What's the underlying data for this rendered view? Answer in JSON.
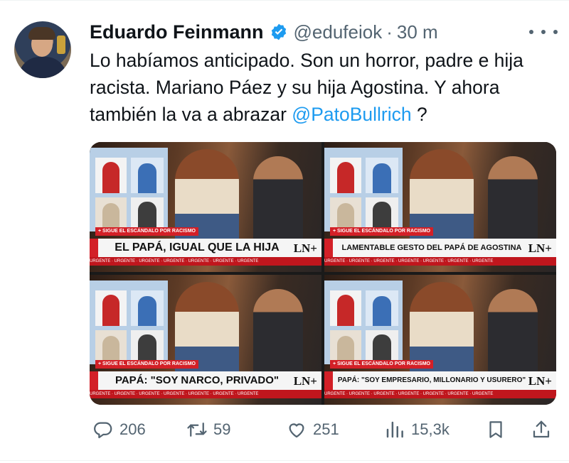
{
  "tweet": {
    "author_name": "Eduardo Feinmann",
    "handle": "@edufeiok",
    "time_separator": "·",
    "time": "30 m",
    "text_parts": [
      "Lo habíamos anticipado. Son un horror, padre e hija racista. Mariano Páez y su hija Agostina. Y ahora también la va a abrazar ",
      "@PatoBullrich",
      " ?"
    ],
    "verified_color": "#1d9bf0"
  },
  "media": {
    "tiles": [
      {
        "banner": "EL PAPÁ, IGUAL QUE LA HIJA",
        "label": "+ SIGUE EL ESCÁNDALO POR RACISMO",
        "logo": "LN+",
        "ticker": "URGENTE · URGENTE · URGENTE · URGENTE · URGENTE · URGENTE · URGENTE"
      },
      {
        "banner": "LAMENTABLE GESTO DEL PAPÁ DE AGOSTINA",
        "label": "+ SIGUE EL ESCÁNDALO POR RACISMO",
        "logo": "LN+",
        "ticker": "URGENTE · URGENTE · URGENTE · URGENTE · URGENTE · URGENTE · URGENTE"
      },
      {
        "banner": "PAPÁ: \"SOY NARCO, PRIVADO\"",
        "label": "+ SIGUE EL ESCÁNDALO POR RACISMO",
        "logo": "LN+",
        "ticker": "URGENTE · URGENTE · URGENTE · URGENTE · URGENTE · URGENTE · URGENTE"
      },
      {
        "banner": "PAPÁ: \"SOY EMPRESARIO, MILLONARIO Y USURERO\"",
        "label": "+ SIGUE EL ESCÁNDALO POR RACISMO",
        "logo": "LN+",
        "ticker": "URGENTE · URGENTE · URGENTE · URGENTE · URGENTE · URGENTE · URGENTE"
      }
    ]
  },
  "actions": {
    "replies": "206",
    "retweets": "59",
    "likes": "251",
    "views": "15,3k",
    "icon_color": "#536471"
  }
}
